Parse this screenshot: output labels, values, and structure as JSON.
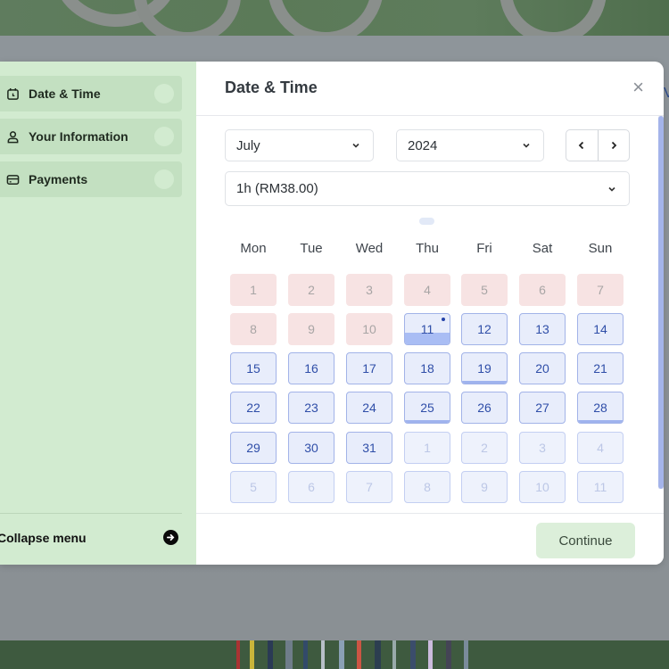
{
  "sidebar": {
    "steps": [
      {
        "label": "Date & Time",
        "icon": "calendar-icon"
      },
      {
        "label": "Your Information",
        "icon": "user-icon"
      },
      {
        "label": "Payments",
        "icon": "credit-card-icon"
      }
    ],
    "collapse_label": "Collapse menu"
  },
  "dialog": {
    "title": "Date & Time",
    "close_glyph": "×",
    "month_select": {
      "value": "July"
    },
    "year_select": {
      "value": "2024"
    },
    "duration_select": {
      "value": "1h  (RM38.00)"
    },
    "prev_glyph": "‹",
    "next_glyph": "›",
    "weekdays": [
      "Mon",
      "Tue",
      "Wed",
      "Thu",
      "Fri",
      "Sat",
      "Sun"
    ],
    "calendar": [
      [
        {
          "d": "1",
          "s": "past"
        },
        {
          "d": "2",
          "s": "past"
        },
        {
          "d": "3",
          "s": "past"
        },
        {
          "d": "4",
          "s": "past"
        },
        {
          "d": "5",
          "s": "past"
        },
        {
          "d": "6",
          "s": "past"
        },
        {
          "d": "7",
          "s": "past"
        }
      ],
      [
        {
          "d": "8",
          "s": "past"
        },
        {
          "d": "9",
          "s": "past"
        },
        {
          "d": "10",
          "s": "past"
        },
        {
          "d": "11",
          "s": "today"
        },
        {
          "d": "12",
          "s": "avail"
        },
        {
          "d": "13",
          "s": "avail"
        },
        {
          "d": "14",
          "s": "avail"
        }
      ],
      [
        {
          "d": "15",
          "s": "avail"
        },
        {
          "d": "16",
          "s": "avail"
        },
        {
          "d": "17",
          "s": "avail"
        },
        {
          "d": "18",
          "s": "avail"
        },
        {
          "d": "19",
          "s": "partial"
        },
        {
          "d": "20",
          "s": "avail"
        },
        {
          "d": "21",
          "s": "avail"
        }
      ],
      [
        {
          "d": "22",
          "s": "avail"
        },
        {
          "d": "23",
          "s": "avail"
        },
        {
          "d": "24",
          "s": "avail"
        },
        {
          "d": "25",
          "s": "partial"
        },
        {
          "d": "26",
          "s": "avail"
        },
        {
          "d": "27",
          "s": "avail"
        },
        {
          "d": "28",
          "s": "partial"
        }
      ],
      [
        {
          "d": "29",
          "s": "avail"
        },
        {
          "d": "30",
          "s": "avail"
        },
        {
          "d": "31",
          "s": "avail"
        },
        {
          "d": "1",
          "s": "other"
        },
        {
          "d": "2",
          "s": "other"
        },
        {
          "d": "3",
          "s": "other"
        },
        {
          "d": "4",
          "s": "other"
        }
      ],
      [
        {
          "d": "5",
          "s": "other"
        },
        {
          "d": "6",
          "s": "other"
        },
        {
          "d": "7",
          "s": "other"
        },
        {
          "d": "8",
          "s": "other"
        },
        {
          "d": "9",
          "s": "other"
        },
        {
          "d": "10",
          "s": "other"
        },
        {
          "d": "11",
          "s": "other"
        }
      ]
    ],
    "continue_label": "Continue"
  },
  "background": {
    "edge_text": "V"
  },
  "colors": {
    "sidebar_bg": "#d2ebd0",
    "available_day": "#e8edfb",
    "past_day": "#f7e3e3",
    "accent_blue": "#2f4ea8",
    "continue_bg": "#dcefda"
  }
}
